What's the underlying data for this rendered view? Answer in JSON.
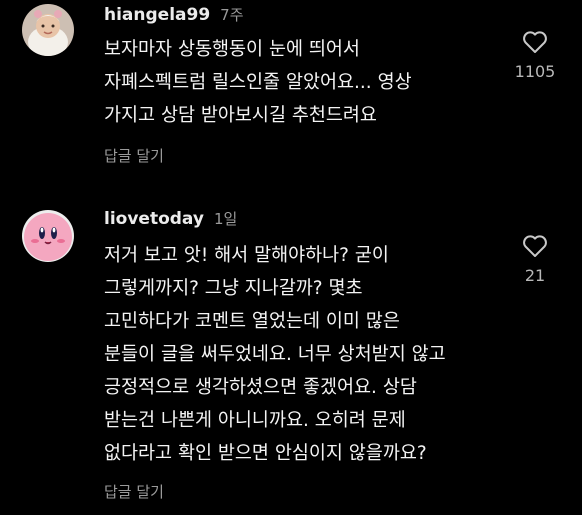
{
  "comments": [
    {
      "username": "hiangela99",
      "time": "7주",
      "lines": [
        "보자마자 상동행동이 눈에 띄어서",
        "자폐스펙트럼 릴스인줄 알았어요... 영상",
        "가지고 상담 받아보시길 추천드려요"
      ],
      "reply_label": "답글 달기",
      "like_count": "1105"
    },
    {
      "username": "liovetoday",
      "time": "1일",
      "lines": [
        "저거 보고 앗! 해서 말해야하나? 굳이",
        "그렇게까지? 그냥 지나갈까? 몇초",
        "고민하다가 코멘트 열었는데 이미 많은",
        "분들이 글을 써두었네요. 너무 상처받지 않고",
        "긍정적으로 생각하셨으면 좋겠어요. 상담",
        "받는건 나쁜게 아니니까요. 오히려 문제",
        "없다라고 확인 받으면 안심이지 않을까요?"
      ],
      "reply_label": "답글 달기",
      "like_count": "21"
    }
  ],
  "colors": {
    "background": "#000000",
    "text": "#f4f4f4",
    "muted": "#9a9a9a",
    "kirby_pink": "#f4a7c0"
  },
  "icons": {
    "like": "heart-outline-icon"
  }
}
